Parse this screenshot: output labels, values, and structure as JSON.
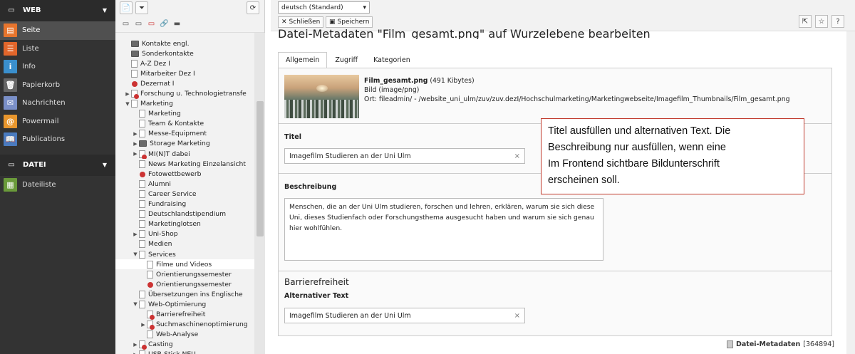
{
  "modmenu": {
    "groups": [
      {
        "label": "WEB",
        "items": [
          {
            "label": "Seite",
            "icon": "page-module-icon",
            "color": "#e8752d"
          },
          {
            "label": "Liste",
            "icon": "list-module-icon",
            "color": "#e2662b"
          },
          {
            "label": "Info",
            "icon": "info-module-icon",
            "color": "#3a8fcd"
          },
          {
            "label": "Papierkorb",
            "icon": "recycler-module-icon",
            "color": "#666666"
          },
          {
            "label": "Nachrichten",
            "icon": "news-module-icon",
            "color": "#7a8fc7"
          },
          {
            "label": "Powermail",
            "icon": "powermail-module-icon",
            "color": "#e8962d"
          },
          {
            "label": "Publications",
            "icon": "publications-module-icon",
            "color": "#4a7bbf"
          }
        ]
      },
      {
        "label": "DATEI",
        "items": [
          {
            "label": "Dateiliste",
            "icon": "filelist-module-icon",
            "color": "#6a9a3a"
          }
        ]
      }
    ]
  },
  "tree": {
    "nodes": [
      {
        "label": "Kontakte engl.",
        "depth": 0,
        "icon": "folder",
        "toggle": ""
      },
      {
        "label": "Sonderkontakte",
        "depth": 0,
        "icon": "folder",
        "toggle": ""
      },
      {
        "label": "A-Z Dez I",
        "depth": 0,
        "icon": "page",
        "toggle": ""
      },
      {
        "label": "Mitarbeiter Dez I",
        "depth": 0,
        "icon": "page",
        "toggle": ""
      },
      {
        "label": "Dezernat I",
        "depth": 0,
        "icon": "redonly",
        "toggle": ""
      },
      {
        "label": "Forschung u. Technologietransfe",
        "depth": 0,
        "icon": "red",
        "toggle": "▶"
      },
      {
        "label": "Marketing",
        "depth": 0,
        "icon": "page",
        "toggle": "▼"
      },
      {
        "label": "Marketing",
        "depth": 1,
        "icon": "page",
        "toggle": ""
      },
      {
        "label": "Team & Kontakte",
        "depth": 1,
        "icon": "page",
        "toggle": ""
      },
      {
        "label": "Messe-Equipment",
        "depth": 1,
        "icon": "page",
        "toggle": "▶"
      },
      {
        "label": "Storage Marketing",
        "depth": 1,
        "icon": "folder",
        "toggle": "▶"
      },
      {
        "label": "MI(N)T dabei",
        "depth": 1,
        "icon": "red",
        "toggle": "▶"
      },
      {
        "label": "News Marketing Einzelansicht",
        "depth": 1,
        "icon": "page",
        "toggle": ""
      },
      {
        "label": "Fotowettbewerb",
        "depth": 1,
        "icon": "redonly",
        "toggle": ""
      },
      {
        "label": "Alumni",
        "depth": 1,
        "icon": "page",
        "toggle": ""
      },
      {
        "label": "Career Service",
        "depth": 1,
        "icon": "page",
        "toggle": ""
      },
      {
        "label": "Fundraising",
        "depth": 1,
        "icon": "page",
        "toggle": ""
      },
      {
        "label": "Deutschlandstipendium",
        "depth": 1,
        "icon": "page",
        "toggle": ""
      },
      {
        "label": "Marketinglotsen",
        "depth": 1,
        "icon": "page",
        "toggle": ""
      },
      {
        "label": "Uni-Shop",
        "depth": 1,
        "icon": "page",
        "toggle": "▶"
      },
      {
        "label": "Medien",
        "depth": 1,
        "icon": "page",
        "toggle": ""
      },
      {
        "label": "Services",
        "depth": 1,
        "icon": "page",
        "toggle": "▼"
      },
      {
        "label": "Filme und Videos",
        "depth": 2,
        "icon": "page",
        "toggle": "",
        "selected": true
      },
      {
        "label": "Orientierungssemester",
        "depth": 2,
        "icon": "page",
        "toggle": ""
      },
      {
        "label": "Orientierungssemester",
        "depth": 2,
        "icon": "redonly",
        "toggle": ""
      },
      {
        "label": "Übersetzungen ins Englische",
        "depth": 1,
        "icon": "page",
        "toggle": ""
      },
      {
        "label": "Web-Optimierung",
        "depth": 1,
        "icon": "page",
        "toggle": "▼"
      },
      {
        "label": "Barrierefreiheit",
        "depth": 2,
        "icon": "red",
        "toggle": ""
      },
      {
        "label": "Suchmaschinenoptimierung",
        "depth": 2,
        "icon": "red",
        "toggle": "▶"
      },
      {
        "label": "Web-Analyse",
        "depth": 2,
        "icon": "page",
        "toggle": ""
      },
      {
        "label": "Casting",
        "depth": 1,
        "icon": "red",
        "toggle": "▶"
      },
      {
        "label": "USB-Stick NEU",
        "depth": 1,
        "icon": "page",
        "toggle": "▶"
      }
    ]
  },
  "doc": {
    "language": "deutsch (Standard)",
    "close_label": "Schließen",
    "save_label": "Speichern",
    "title": "Datei-Metadaten \"Film_gesamt.png\" auf Wurzelebene bearbeiten",
    "tabs": [
      "Allgemein",
      "Zugriff",
      "Kategorien"
    ],
    "file": {
      "name": "Film_gesamt.png",
      "size": "(491 Kibytes)",
      "type": "Bild (image/png)",
      "location": "Ort: fileadmin/ - /website_uni_ulm/zuv/zuv.dezI/Hochschulmarketing/Marketingwebseite/Imagefilm_Thumbnails/Film_gesamt.png"
    },
    "titel_label": "Titel",
    "titel_value": "Imagefilm Studieren an der Uni Ulm",
    "beschreibung_label": "Beschreibung",
    "beschreibung_value": "Menschen, die an der Uni Ulm studieren, forschen und lehren, erklären, warum sie sich diese Uni, dieses Studienfach oder Forschungsthema ausgesucht haben und warum sie sich genau hier wohlfühlen.",
    "barriere_heading": "Barrierefreiheit",
    "alt_label": "Alternativer Text",
    "alt_value": "Imagefilm Studieren an der Uni Ulm",
    "footer_label": "Datei-Metadaten",
    "footer_id": "[364894]"
  },
  "callout": {
    "lines": [
      "Titel ausfüllen und alternativen  Text. Die",
      "Beschreibung  nur ausfüllen, wenn eine",
      "Im Frontend sichtbare Bildunterschrift",
      "erscheinen  soll."
    ]
  }
}
